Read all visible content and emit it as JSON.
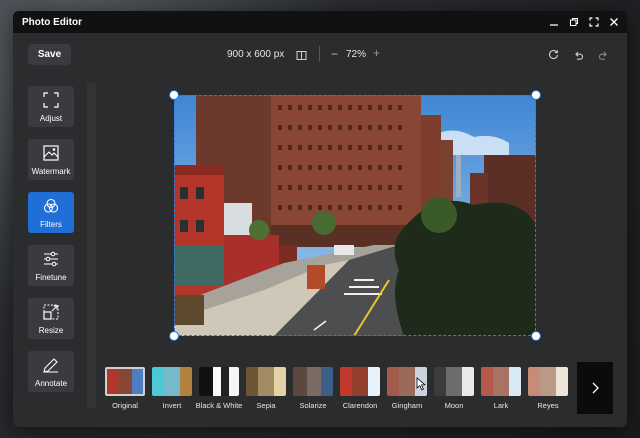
{
  "window": {
    "title": "Photo Editor"
  },
  "toolbar": {
    "save_label": "Save",
    "dimensions": "900 x 600 px",
    "zoom_out": "−",
    "zoom_level": "72%",
    "zoom_in": "+"
  },
  "sidebar": {
    "items": [
      {
        "label": "Adjust",
        "icon": "crop-icon"
      },
      {
        "label": "Watermark",
        "icon": "image-icon"
      },
      {
        "label": "Filters",
        "icon": "circles-icon",
        "active": true
      },
      {
        "label": "Finetune",
        "icon": "sliders-icon"
      },
      {
        "label": "Resize",
        "icon": "resize-icon"
      },
      {
        "label": "Annotate",
        "icon": "pencil-icon"
      }
    ]
  },
  "filters": {
    "items": [
      {
        "label": "Original",
        "selected": true
      },
      {
        "label": "Invert"
      },
      {
        "label": "Black & White"
      },
      {
        "label": "Sepia"
      },
      {
        "label": "Solarize"
      },
      {
        "label": "Clarendon"
      },
      {
        "label": "Gingham"
      },
      {
        "label": "Moon"
      },
      {
        "label": "Lark"
      },
      {
        "label": "Reyes"
      }
    ]
  },
  "colors": {
    "accent": "#1f6fd6",
    "background": "#2b2c2e",
    "titlebar": "#101112"
  }
}
